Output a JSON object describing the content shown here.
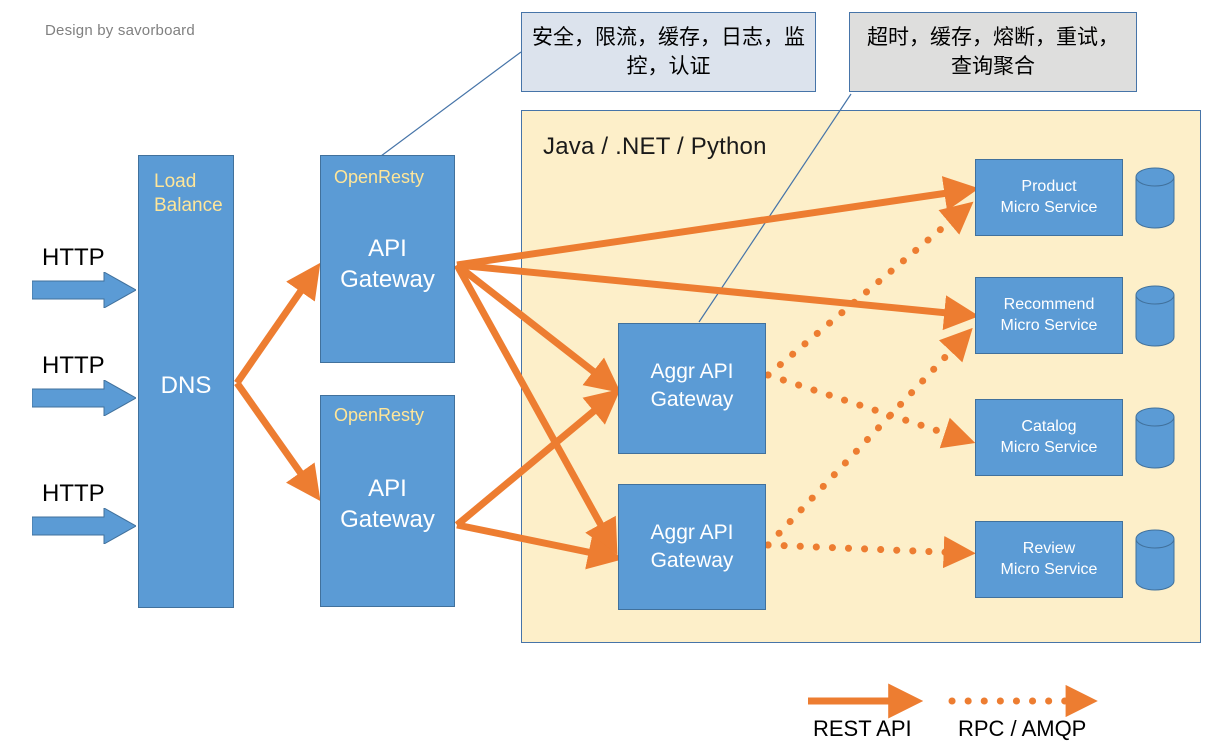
{
  "credit": "Design by savorboard",
  "callouts": [
    {
      "id": "security",
      "text": "安全，限流，缓存，日志，监控，认证"
    },
    {
      "id": "resilience",
      "text": "超时，缓存，熔断，重试，查询聚合"
    }
  ],
  "panel": {
    "title": "Java / .NET / Python",
    "background": "#FDEFC9",
    "border": "#4674A8"
  },
  "load_balancer": {
    "sublabel": "Load Balance",
    "label": "DNS"
  },
  "http_entries": [
    {
      "label": "HTTP"
    },
    {
      "label": "HTTP"
    },
    {
      "label": "HTTP"
    }
  ],
  "api_gateways": [
    {
      "sublabel": "OpenResty",
      "label": "API\nGateway",
      "line1": "API",
      "line2": "Gateway"
    },
    {
      "sublabel": "OpenResty",
      "label": "API\nGateway",
      "line1": "API",
      "line2": "Gateway"
    }
  ],
  "aggr_gateways": [
    {
      "line1": "Aggr API",
      "line2": "Gateway"
    },
    {
      "line1": "Aggr API",
      "line2": "Gateway"
    }
  ],
  "microservices": [
    {
      "name": "Product",
      "suffix": "Micro Service",
      "db": "database-cylinder"
    },
    {
      "name": "Recommend",
      "suffix": "Micro Service",
      "db": "database-cylinder"
    },
    {
      "name": "Catalog",
      "suffix": "Micro Service",
      "db": "database-cylinder"
    },
    {
      "name": "Review",
      "suffix": "Micro Service",
      "db": "database-cylinder"
    }
  ],
  "legend": {
    "rest": "REST API",
    "rpc": "RPC / AMQP"
  },
  "colors": {
    "blue_fill": "#5B9BD5",
    "blue_border": "#41719C",
    "orange": "#ED7D31",
    "cream": "#FDEFC9",
    "callout_security_fill": "#DCE3ED",
    "callout_resilience_fill": "#DEDEDD",
    "yellow_text": "#FFE699",
    "credit_gray": "#808080"
  }
}
